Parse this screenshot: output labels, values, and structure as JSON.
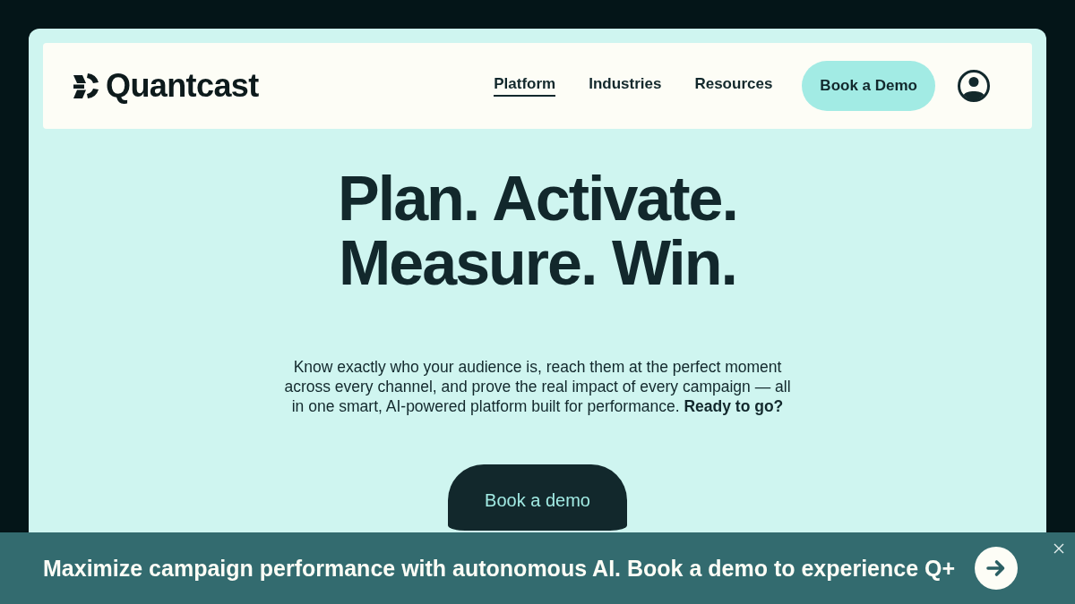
{
  "header": {
    "logo": {
      "text": "Quantcast"
    },
    "nav": [
      {
        "label": "Platform",
        "selected": true
      },
      {
        "label": "Industries",
        "selected": false
      },
      {
        "label": "Resources",
        "selected": false
      }
    ],
    "cta": "Book a Demo"
  },
  "hero": {
    "headline": [
      "Plan. Activate.",
      "Measure. Win."
    ],
    "body": "Know exactly who your audience is, reach them at the perfect moment across every channel, and prove the real impact of every campaign — all in one smart, AI-powered platform built for performance. **Ready to go?**",
    "button": "Book a demo"
  },
  "banner": {
    "text": "Maximize campaign performance with autonomous AI. Book a demo to experience Q+"
  }
}
